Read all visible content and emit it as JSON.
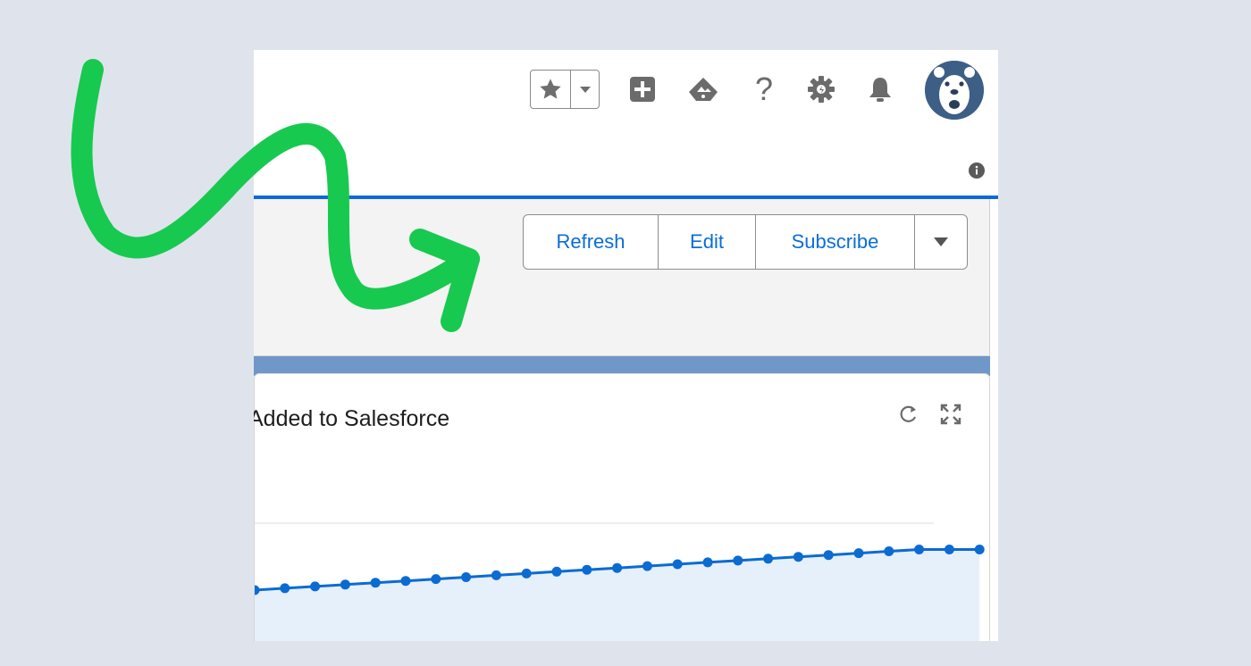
{
  "header": {
    "favorites": {
      "star_icon": "star-icon",
      "menu_icon": "chevron-down-icon"
    },
    "icons": [
      "add-icon",
      "trailhead-icon",
      "help-icon",
      "setup-gear-icon",
      "notifications-bell-icon"
    ],
    "help_glyph": "?",
    "avatar_icon": "bear-avatar-icon",
    "info_icon": "info-icon"
  },
  "actions": {
    "refresh_label": "Refresh",
    "edit_label": "Edit",
    "subscribe_label": "Subscribe",
    "more_icon": "chevron-down-icon"
  },
  "report_card": {
    "title": "Added to Salesforce",
    "refresh_icon": "refresh-icon",
    "expand_icon": "expand-icon"
  },
  "annotation": {
    "arrow_color": "#18c94f"
  },
  "colors": {
    "accent": "#0a6dd8",
    "line": "#0b6bd3",
    "area_fill": "#e6f0fa"
  },
  "chart_data": {
    "type": "area",
    "title": "Added to Salesforce",
    "xlabel": "",
    "ylabel": "",
    "series": [
      {
        "values": [
          0,
          1,
          2,
          3,
          4,
          5,
          6,
          7,
          8,
          9,
          10,
          11,
          12,
          13,
          14,
          15,
          16,
          17,
          18,
          19,
          20,
          21,
          22,
          22,
          22
        ]
      }
    ],
    "grid": true,
    "legend": "none"
  }
}
